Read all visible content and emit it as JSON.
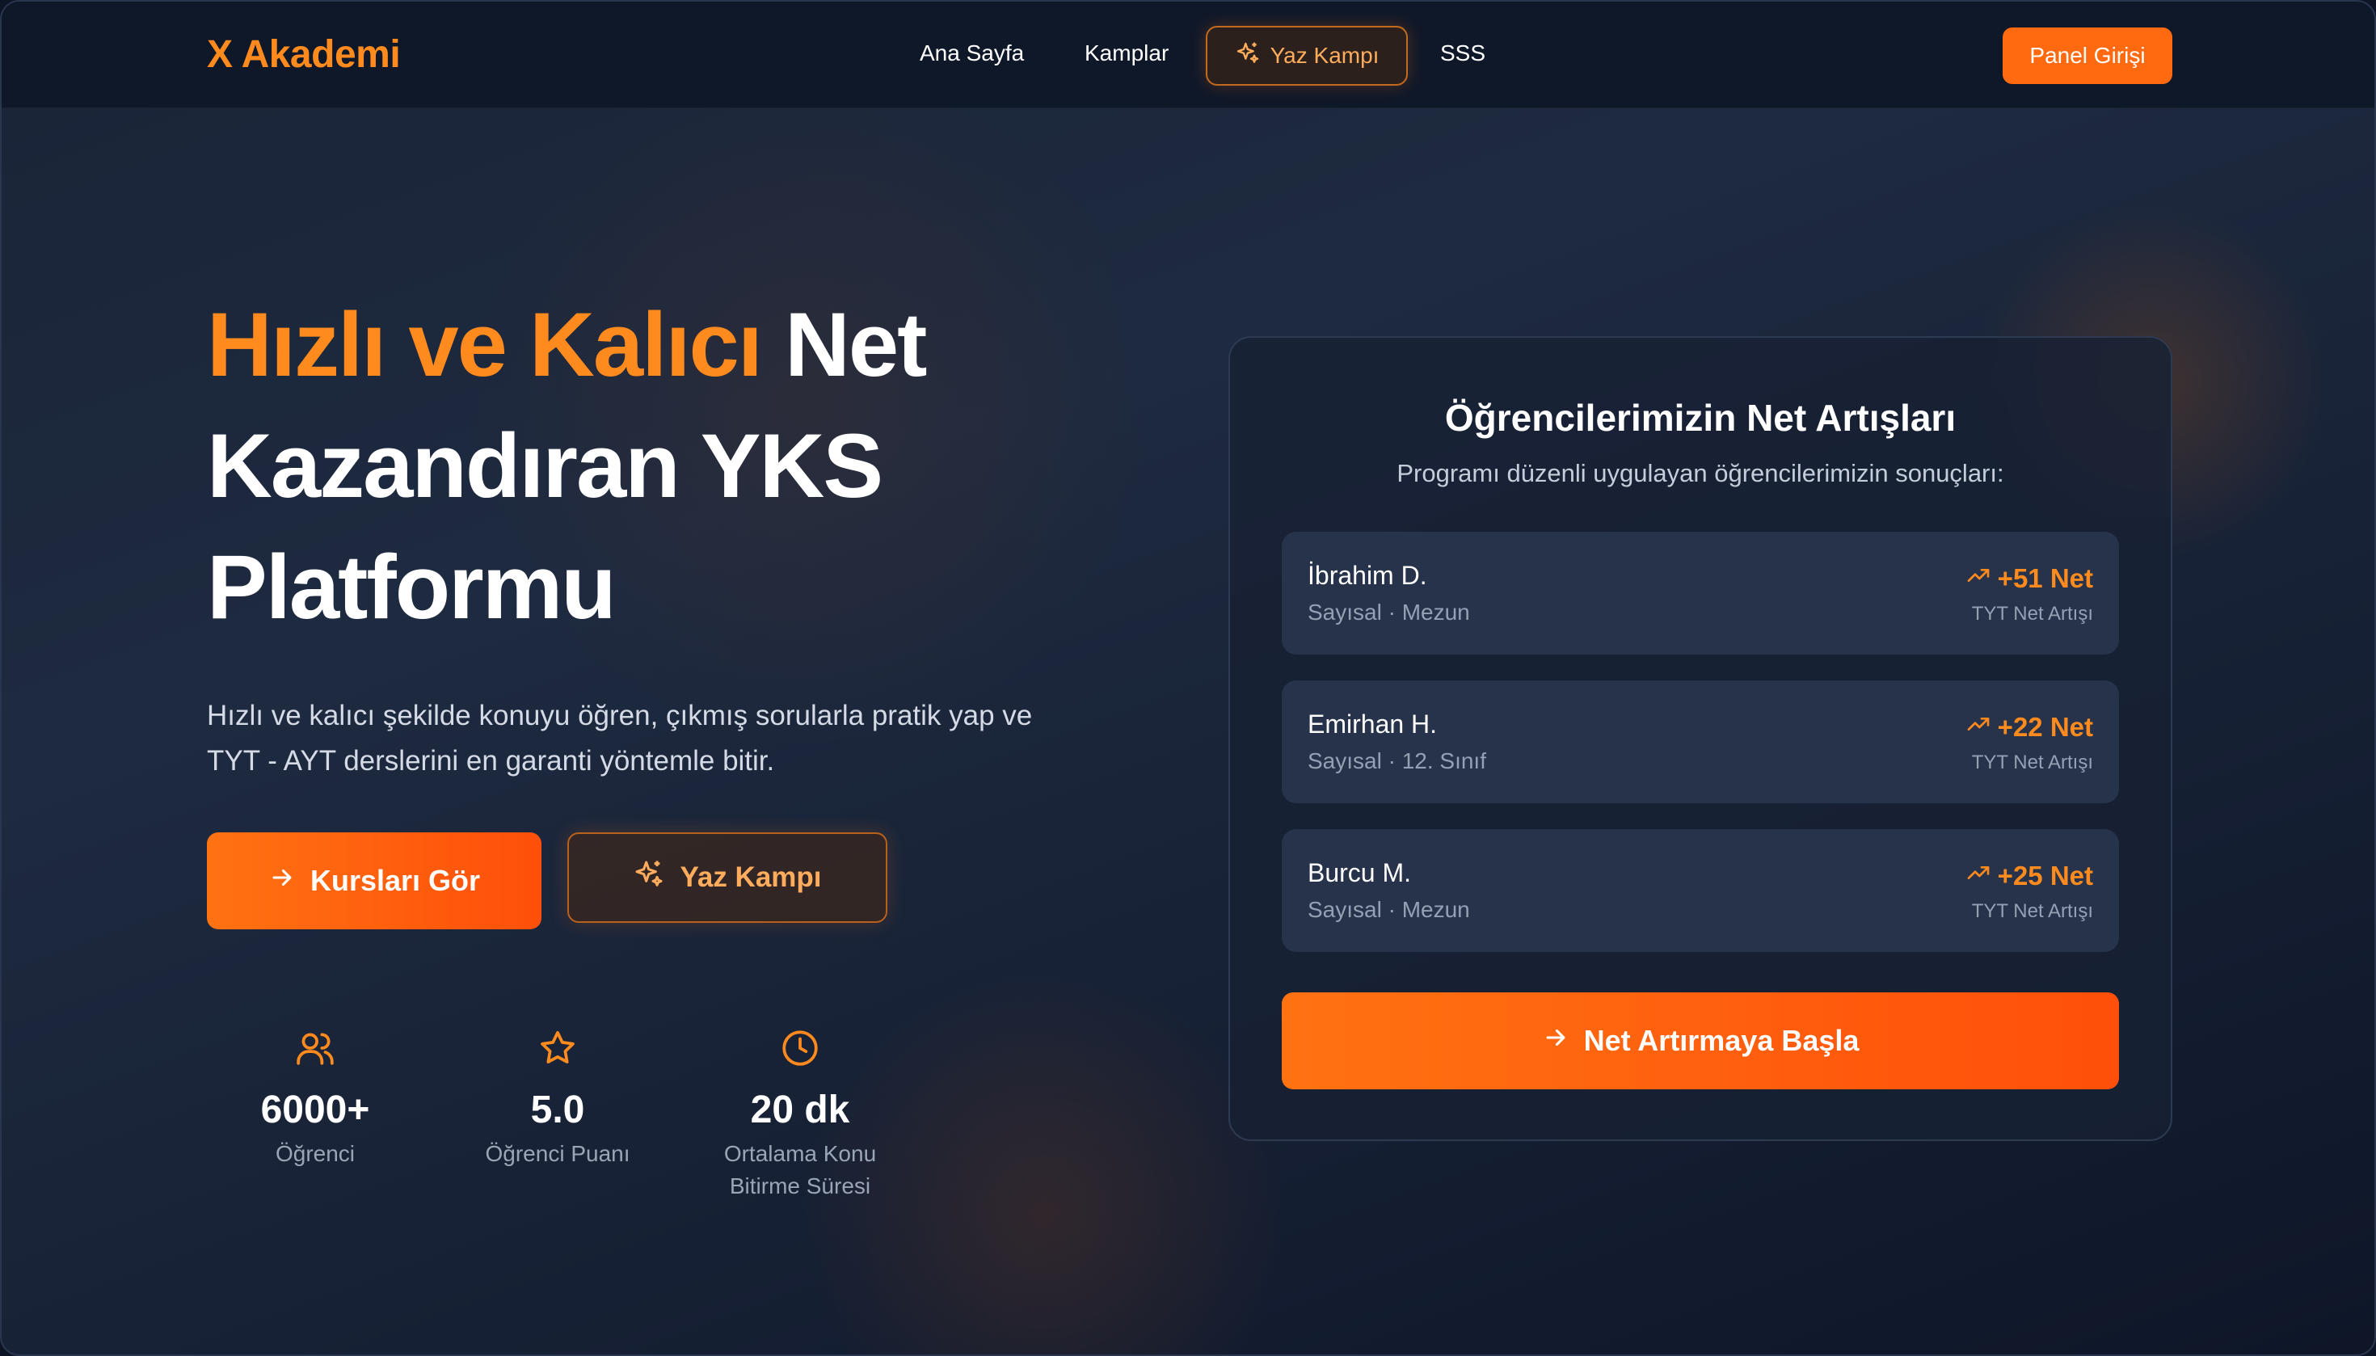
{
  "nav": {
    "logo": "X Akademi",
    "links": [
      "Ana Sayfa",
      "Kamplar",
      "SSS"
    ],
    "camp_label": "Yaz Kampı",
    "panel_label": "Panel Girişi"
  },
  "hero": {
    "title_accent": "Hızlı ve Kalıcı",
    "title_rest": "Net Kazandıran YKS Platformu",
    "subtitle": "Hızlı ve kalıcı şekilde konuyu öğren, çıkmış sorularla pratik yap ve TYT - AYT derslerini en garanti yöntemle bitir.",
    "primary_button": "Kursları Gör",
    "secondary_button": "Yaz Kampı",
    "stats": [
      {
        "icon": "users-icon",
        "value": "6000+",
        "label": "Öğrenci"
      },
      {
        "icon": "star-icon",
        "value": "5.0",
        "label": "Öğrenci Puanı"
      },
      {
        "icon": "clock-icon",
        "value": "20 dk",
        "label": "Ortalama Konu Bitirme Süresi"
      }
    ]
  },
  "results_card": {
    "title": "Öğrencilerimizin Net Artışları",
    "subtitle": "Programı düzenli uygulayan öğrencilerimizin sonuçları:",
    "items": [
      {
        "name": "İbrahim D.",
        "meta": "Sayısal · Mezun",
        "gain": "+51 Net",
        "gain_label": "TYT Net Artışı"
      },
      {
        "name": "Emirhan H.",
        "meta": "Sayısal · 12. Sınıf",
        "gain": "+22 Net",
        "gain_label": "TYT Net Artışı"
      },
      {
        "name": "Burcu M.",
        "meta": "Sayısal · Mezun",
        "gain": "+25 Net",
        "gain_label": "TYT Net Artışı"
      }
    ],
    "cta": "Net Artırmaya Başla"
  },
  "colors": {
    "accent": "#ff8a1e",
    "accent_strong": "#ff5a0c",
    "background": "#172135"
  }
}
